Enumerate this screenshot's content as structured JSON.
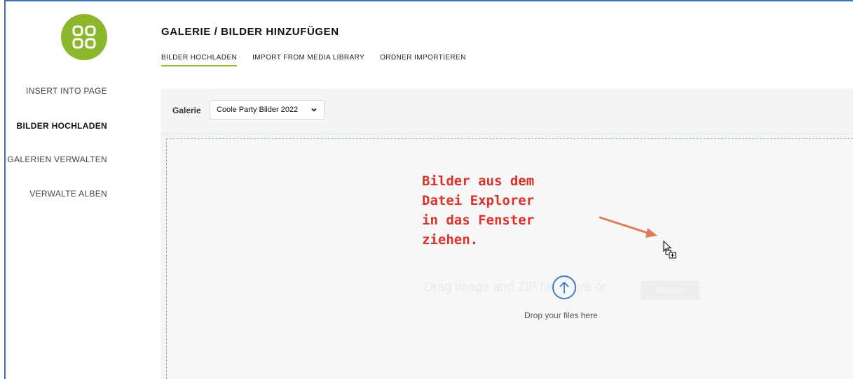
{
  "sidebar": {
    "items": [
      {
        "label": "INSERT INTO PAGE",
        "active": false
      },
      {
        "label": "BILDER HOCHLADEN",
        "active": true
      },
      {
        "label": "GALERIEN VERWALTEN",
        "active": false
      },
      {
        "label": "VERWALTE ALBEN",
        "active": false
      }
    ]
  },
  "header": {
    "title": "GALERIE / BILDER HINZUFÜGEN",
    "tabs": [
      {
        "label": "BILDER HOCHLADEN",
        "active": true
      },
      {
        "label": "IMPORT FROM MEDIA LIBRARY",
        "active": false
      },
      {
        "label": "ORDNER IMPORTIEREN",
        "active": false
      }
    ]
  },
  "gallery": {
    "label": "Galerie",
    "selected": "Coole Party Bilder 2022"
  },
  "dropzone": {
    "drag_text": "Drag image and ZIP files here or",
    "browse_label": "BROWSE",
    "drop_text": "Drop your files here"
  },
  "annotation": {
    "lines": [
      "Bilder aus dem",
      "Datei Explorer",
      "in das Fenster",
      "ziehen."
    ]
  },
  "colors": {
    "accent": "#8cb62b",
    "annotation": "#d8332c",
    "upload_icon": "#3c7cc8"
  },
  "icons": {
    "logo": "grid-logo-icon",
    "select": "chevron-down-icon",
    "upload": "upload-arrow-icon",
    "cursor": "drag-copy-cursor-icon"
  }
}
